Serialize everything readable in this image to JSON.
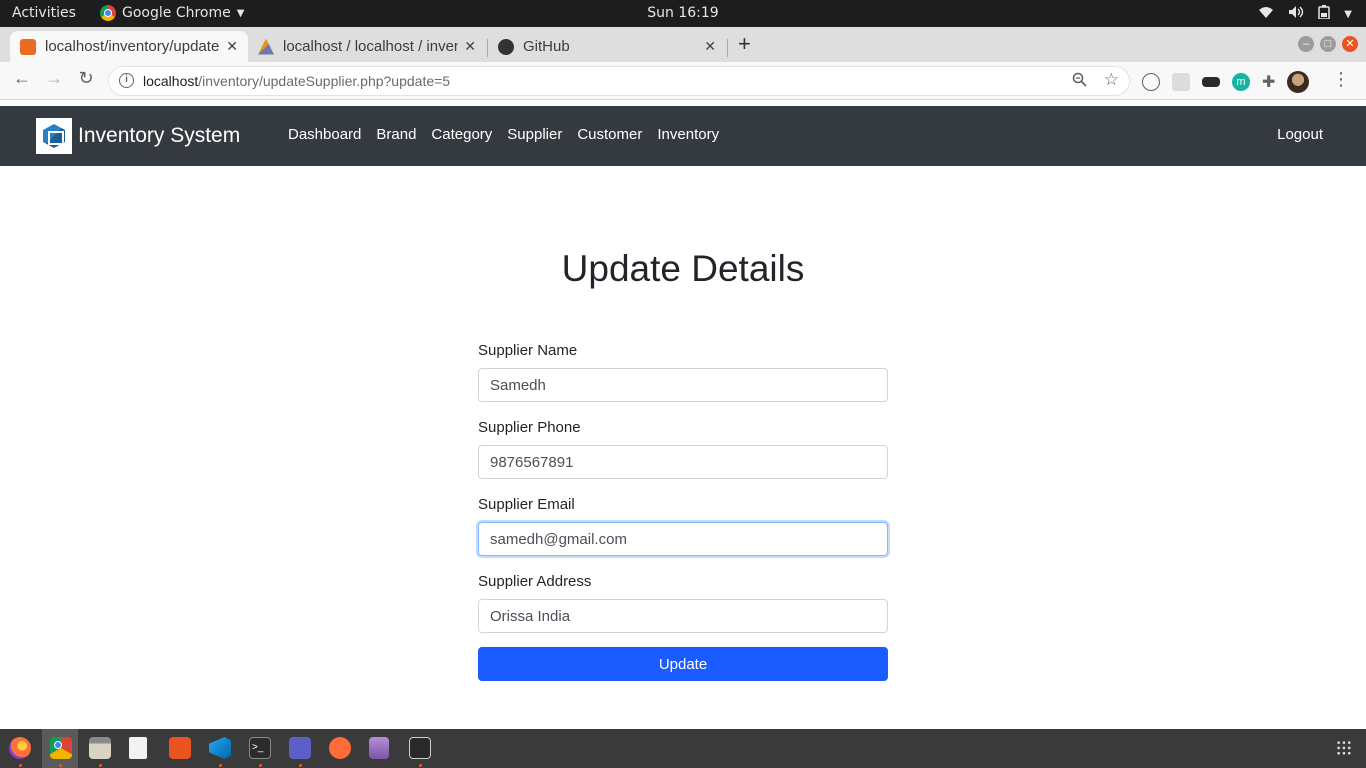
{
  "desktop": {
    "activities": "Activities",
    "app_name": "Google Chrome",
    "clock": "Sun 16:19"
  },
  "browser": {
    "tabs": [
      {
        "title": "localhost/inventory/update",
        "favicon": "xampp-icon",
        "favicon_color": "#e86b1f"
      },
      {
        "title": "localhost / localhost / inventory",
        "favicon": "phpmyadmin-icon",
        "favicon_color": "#f29111"
      },
      {
        "title": "GitHub",
        "favicon": "github-icon",
        "favicon_color": "#333333"
      }
    ],
    "url_host": "localhost",
    "url_path": "/inventory/updateSupplier.php?update=5"
  },
  "app": {
    "brand": "Inventory System",
    "nav": [
      "Dashboard",
      "Brand",
      "Category",
      "Supplier",
      "Customer",
      "Inventory"
    ],
    "logout": "Logout",
    "colors": {
      "navbar": "#343a40",
      "primary": "#1a5cff"
    }
  },
  "page": {
    "title": "Update Details",
    "fields": [
      {
        "label": "Supplier Name",
        "value": "Samedh"
      },
      {
        "label": "Supplier Phone",
        "value": "9876567891"
      },
      {
        "label": "Supplier Email",
        "value": "samedh@gmail.com"
      },
      {
        "label": "Supplier Address",
        "value": "Orissa India"
      }
    ],
    "submit_label": "Update"
  },
  "dock": {
    "apps": [
      "firefox",
      "chrome",
      "files",
      "libreoffice-writer",
      "software-center",
      "vscode",
      "terminal",
      "teams",
      "postman",
      "database",
      "screen-recorder"
    ]
  }
}
